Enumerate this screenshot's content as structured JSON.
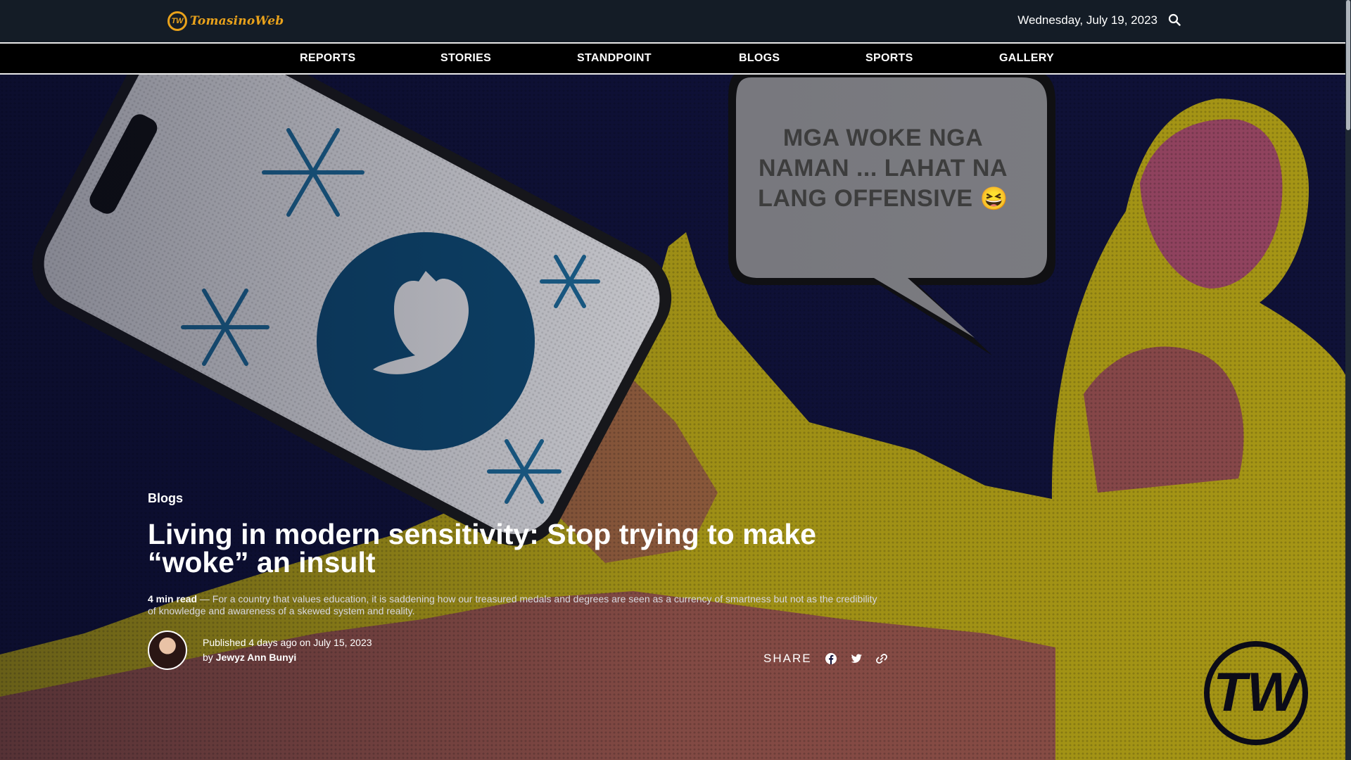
{
  "brand": {
    "logo_text": "TomasinoWeb",
    "logo_mark": "TW",
    "accent": "#e9a21b"
  },
  "header": {
    "date": "Wednesday, July 19, 2023",
    "search_icon": "search-icon"
  },
  "nav": {
    "items": [
      {
        "label": "REPORTS"
      },
      {
        "label": "STORIES"
      },
      {
        "label": "STANDPOINT"
      },
      {
        "label": "BLOGS"
      },
      {
        "label": "SPORTS"
      },
      {
        "label": "GALLERY"
      }
    ]
  },
  "hero": {
    "bubble_line1": "MGA WOKE NGA",
    "bubble_line2": "NAMAN ... LAHAT NA",
    "bubble_line3": "LANG OFFENSIVE",
    "bubble_emoji": "😆"
  },
  "article": {
    "category": "Blogs",
    "title": "Living in modern sensitivity: Stop trying to make “woke” an insult",
    "read_time": "4 min read",
    "excerpt": " — For a country that values education, it is saddening how our treasured medals and degrees are seen as a currency of smartness but not as the credibility of knowledge and awareness of a skewed system and reality.",
    "published_prefix": "Published ",
    "published_ago": "4 days ago",
    "published_on": " on ",
    "published_date": "July 15, 2023",
    "by": "by ",
    "author": "Jewyz Ann Bunyi"
  },
  "share": {
    "label": "SHARE",
    "icons": [
      "facebook-icon",
      "twitter-icon",
      "link-icon"
    ]
  }
}
